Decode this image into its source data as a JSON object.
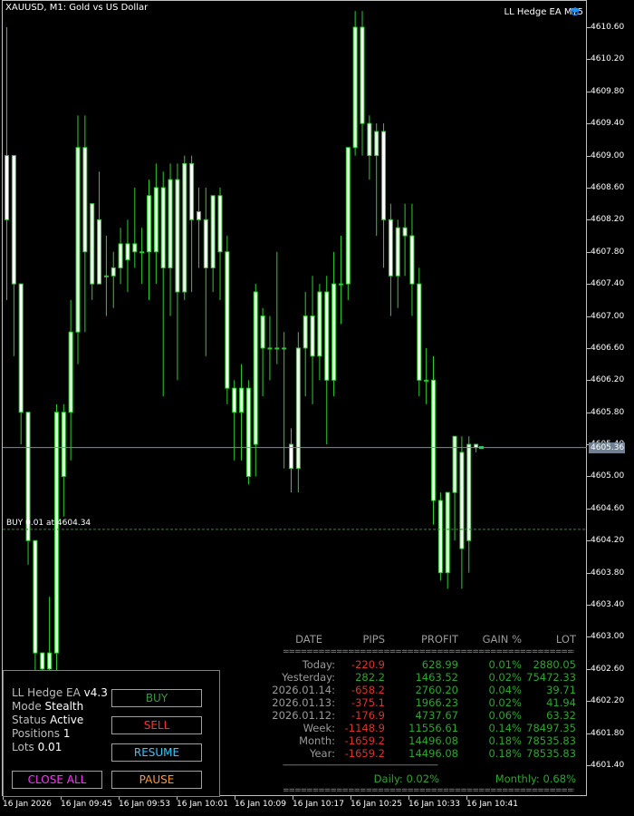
{
  "window": {
    "symbol_title": "XAUUSD, M1:  Gold vs US Dollar",
    "ea_title": "LL Hedge EA MT5",
    "cap_icon": "graduation-cap-icon"
  },
  "chart_data": {
    "type": "candlestick",
    "ylim": [
      4600.0,
      4610.9
    ],
    "price_ticks": [
      "4610.60",
      "4610.20",
      "4609.80",
      "4609.40",
      "4609.00",
      "4608.60",
      "4608.20",
      "4607.80",
      "4607.40",
      "4607.00",
      "4606.60",
      "4606.20",
      "4605.80",
      "4605.40",
      "4605.00",
      "4604.60",
      "4604.20",
      "4603.80",
      "4603.40",
      "4603.00",
      "4602.60",
      "4602.20",
      "4601.80",
      "4601.40"
    ],
    "bid_price": "4605.36",
    "order_line_price": 4604.34,
    "order_label": "BUY 0.01 at 4604.34",
    "time_labels": [
      "16 Jan 2026",
      "16 Jan 09:45",
      "16 Jan 09:53",
      "16 Jan 10:01",
      "16 Jan 10:09",
      "16 Jan 10:17",
      "16 Jan 10:25",
      "16 Jan 10:33",
      "16 Jan 10:41"
    ],
    "candles": [
      {
        "o": 4609.0,
        "h": 4610.6,
        "c": 4608.2,
        "l": 4607.2
      },
      {
        "o": 4609.0,
        "h": 4609.0,
        "c": 4607.4,
        "l": 4606.5
      },
      {
        "o": 4607.4,
        "h": 4607.4,
        "c": 4605.8,
        "l": 4605.4
      },
      {
        "o": 4605.8,
        "h": 4605.8,
        "c": 4604.2,
        "l": 4603.9
      },
      {
        "o": 4604.2,
        "h": 4604.2,
        "c": 4602.8,
        "l": 4602.4
      },
      {
        "o": 4602.8,
        "h": 4602.8,
        "c": 4602.6,
        "l": 4601.6
      },
      {
        "o": 4602.6,
        "h": 4603.5,
        "c": 4602.8,
        "l": 4602.1
      },
      {
        "o": 4602.8,
        "h": 4605.9,
        "c": 4605.8,
        "l": 4602.2
      },
      {
        "o": 4605.0,
        "h": 4605.9,
        "c": 4605.8,
        "l": 4604.5
      },
      {
        "o": 4605.8,
        "h": 4607.2,
        "c": 4606.8,
        "l": 4605.2
      },
      {
        "o": 4606.8,
        "h": 4609.5,
        "c": 4609.1,
        "l": 4606.4
      },
      {
        "o": 4609.1,
        "h": 4609.5,
        "c": 4607.8,
        "l": 4606.8
      },
      {
        "o": 4607.4,
        "h": 4608.4,
        "c": 4608.4,
        "l": 4607.2
      },
      {
        "o": 4607.4,
        "h": 4608.8,
        "c": 4608.2,
        "l": 4607.4
      },
      {
        "o": 4607.5,
        "h": 4608.0,
        "c": 4607.5,
        "l": 4607.0
      },
      {
        "o": 4607.5,
        "h": 4607.8,
        "c": 4607.6,
        "l": 4607.1
      },
      {
        "o": 4607.6,
        "h": 4608.1,
        "c": 4607.9,
        "l": 4607.4
      },
      {
        "o": 4607.9,
        "h": 4608.2,
        "c": 4607.7,
        "l": 4607.3
      },
      {
        "o": 4607.8,
        "h": 4608.6,
        "c": 4607.9,
        "l": 4607.6
      },
      {
        "o": 4607.8,
        "h": 4608.1,
        "c": 4607.8,
        "l": 4607.4
      },
      {
        "o": 4607.8,
        "h": 4608.7,
        "c": 4608.5,
        "l": 4607.2
      },
      {
        "o": 4607.8,
        "h": 4608.9,
        "c": 4608.6,
        "l": 4607.4
      },
      {
        "o": 4608.6,
        "h": 4608.8,
        "c": 4607.6,
        "l": 4606.0
      },
      {
        "o": 4607.6,
        "h": 4608.9,
        "c": 4608.7,
        "l": 4607.0
      },
      {
        "o": 4608.7,
        "h": 4608.9,
        "c": 4607.3,
        "l": 4606.2
      },
      {
        "o": 4607.3,
        "h": 4609.0,
        "c": 4608.9,
        "l": 4607.2
      },
      {
        "o": 4608.9,
        "h": 4609.0,
        "c": 4608.2,
        "l": 4607.3
      },
      {
        "o": 4608.3,
        "h": 4608.6,
        "c": 4608.2,
        "l": 4607.6
      },
      {
        "o": 4608.2,
        "h": 4608.6,
        "c": 4607.6,
        "l": 4606.5
      },
      {
        "o": 4607.6,
        "h": 4608.5,
        "c": 4608.5,
        "l": 4607.3
      },
      {
        "o": 4608.5,
        "h": 4608.6,
        "c": 4607.8,
        "l": 4607.2
      },
      {
        "o": 4607.8,
        "h": 4608.0,
        "c": 4606.1,
        "l": 4605.9
      },
      {
        "o": 4606.1,
        "h": 4606.2,
        "c": 4605.8,
        "l": 4605.2
      },
      {
        "o": 4605.8,
        "h": 4606.4,
        "c": 4606.1,
        "l": 4605.2
      },
      {
        "o": 4606.1,
        "h": 4606.2,
        "c": 4605.0,
        "l": 4604.9
      },
      {
        "o": 4605.4,
        "h": 4607.4,
        "c": 4607.3,
        "l": 4605.0
      },
      {
        "o": 4606.6,
        "h": 4607.1,
        "c": 4607.0,
        "l": 4606.0
      },
      {
        "o": 4606.6,
        "h": 4607.0,
        "c": 4606.6,
        "l": 4606.2
      },
      {
        "o": 4606.6,
        "h": 4607.8,
        "c": 4606.6,
        "l": 4606.4
      },
      {
        "o": 4606.6,
        "h": 4606.8,
        "c": 4606.6,
        "l": 4605.1
      },
      {
        "o": 4605.4,
        "h": 4605.6,
        "c": 4605.1,
        "l": 4604.8
      },
      {
        "o": 4605.1,
        "h": 4606.8,
        "c": 4606.6,
        "l": 4604.8
      },
      {
        "o": 4606.6,
        "h": 4607.3,
        "c": 4607.0,
        "l": 4606.0
      },
      {
        "o": 4607.0,
        "h": 4607.5,
        "c": 4606.5,
        "l": 4605.9
      },
      {
        "o": 4606.5,
        "h": 4607.4,
        "c": 4607.3,
        "l": 4606.2
      },
      {
        "o": 4607.3,
        "h": 4607.5,
        "c": 4606.2,
        "l": 4605.4
      },
      {
        "o": 4606.2,
        "h": 4607.8,
        "c": 4607.4,
        "l": 4606.0
      },
      {
        "o": 4607.4,
        "h": 4608.0,
        "c": 4607.4,
        "l": 4606.9
      },
      {
        "o": 4607.4,
        "h": 4609.1,
        "c": 4609.1,
        "l": 4607.2
      },
      {
        "o": 4609.1,
        "h": 4610.8,
        "c": 4610.6,
        "l": 4609.0
      },
      {
        "o": 4610.6,
        "h": 4610.8,
        "c": 4609.4,
        "l": 4609.0
      },
      {
        "o": 4609.4,
        "h": 4609.5,
        "c": 4609.0,
        "l": 4608.7
      },
      {
        "o": 4609.0,
        "h": 4609.4,
        "c": 4609.3,
        "l": 4608.0
      },
      {
        "o": 4609.3,
        "h": 4609.4,
        "c": 4608.2,
        "l": 4607.6
      },
      {
        "o": 4608.2,
        "h": 4608.4,
        "c": 4607.5,
        "l": 4607.0
      },
      {
        "o": 4607.5,
        "h": 4608.2,
        "c": 4608.1,
        "l": 4607.1
      },
      {
        "o": 4608.1,
        "h": 4608.4,
        "c": 4608.0,
        "l": 4607.5
      },
      {
        "o": 4608.0,
        "h": 4608.4,
        "c": 4607.4,
        "l": 4607.0
      },
      {
        "o": 4607.4,
        "h": 4607.6,
        "c": 4606.2,
        "l": 4606.0
      },
      {
        "o": 4606.2,
        "h": 4606.6,
        "c": 4606.2,
        "l": 4605.9
      },
      {
        "o": 4606.2,
        "h": 4606.5,
        "c": 4604.7,
        "l": 4604.4
      },
      {
        "o": 4604.7,
        "h": 4604.8,
        "c": 4603.8,
        "l": 4603.7
      },
      {
        "o": 4603.8,
        "h": 4604.8,
        "c": 4604.8,
        "l": 4603.6
      },
      {
        "o": 4604.8,
        "h": 4605.5,
        "c": 4605.5,
        "l": 4604.2
      },
      {
        "o": 4605.3,
        "h": 4605.5,
        "c": 4604.1,
        "l": 4603.6
      },
      {
        "o": 4604.2,
        "h": 4605.5,
        "c": 4605.4,
        "l": 4603.8
      },
      {
        "o": 4605.4,
        "h": 4605.4,
        "c": 4605.36,
        "l": 4605.3
      }
    ]
  },
  "panel": {
    "ea_name": "LL Hedge EA",
    "ea_version": "v4.3",
    "mode_label": "Mode",
    "mode_value": "Stealth",
    "status_label": "Status",
    "status_value": "Active",
    "positions_label": "Positions",
    "positions_value": "1",
    "lots_label": "Lots",
    "lots_value": "0.01",
    "buy_label": "BUY",
    "sell_label": "SELL",
    "resume_label": "RESUME",
    "close_all_label": "CLOSE ALL",
    "pause_label": "PAUSE",
    "colors": {
      "buy": "#3a9a3a",
      "sell": "#ff3030",
      "resume": "#33c8ff",
      "close_all": "#ff33ff",
      "pause": "#ff9a33"
    }
  },
  "stats": {
    "headers": {
      "date": "DATE",
      "pips": "PIPS",
      "profit": "PROFIT",
      "gain": "GAIN %",
      "lot": "LOT"
    },
    "separator": "=========================================================================",
    "separator_dashed": "----------------------------------------------------------------------------",
    "rows": [
      {
        "date": "Today:",
        "pips": "-220.9",
        "profit": "628.99",
        "gain": "0.01%",
        "lot": "2880.05"
      },
      {
        "date": "Yesterday:",
        "pips": "282.2",
        "profit": "1463.52",
        "gain": "0.02%",
        "lot": "75472.33"
      },
      {
        "date": "2026.01.14:",
        "pips": "-658.2",
        "profit": "2760.20",
        "gain": "0.04%",
        "lot": "39.71"
      },
      {
        "date": "2026.01.13:",
        "pips": "-375.1",
        "profit": "1966.23",
        "gain": "0.02%",
        "lot": "41.94"
      },
      {
        "date": "2026.01.12:",
        "pips": "-176.9",
        "profit": "4737.67",
        "gain": "0.06%",
        "lot": "63.32"
      },
      {
        "date": "Week:",
        "pips": "-1148.9",
        "profit": "11556.61",
        "gain": "0.14%",
        "lot": "78497.35"
      },
      {
        "date": "Month:",
        "pips": "-1659.2",
        "profit": "14496.08",
        "gain": "0.18%",
        "lot": "78535.83"
      },
      {
        "date": "Year:",
        "pips": "-1659.2",
        "profit": "14496.08",
        "gain": "0.18%",
        "lot": "78535.83"
      }
    ],
    "daily": "Daily: 0.02%",
    "monthly": "Monthly: 0.68%"
  }
}
